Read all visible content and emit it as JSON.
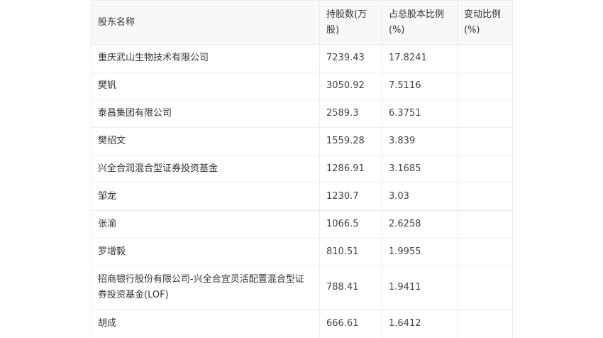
{
  "table": {
    "headers": [
      "股东名称",
      "持股数(万股)",
      "占总股本比例(%)",
      "变动比例(%)"
    ],
    "rows": [
      {
        "name": "重庆武山生物技术有限公司",
        "shares": "7239.43",
        "ratio": "17.8241",
        "change": ""
      },
      {
        "name": "樊钒",
        "shares": "3050.92",
        "ratio": "7.5116",
        "change": ""
      },
      {
        "name": "泰昌集团有限公司",
        "shares": "2589.3",
        "ratio": "6.3751",
        "change": ""
      },
      {
        "name": "樊绍文",
        "shares": "1559.28",
        "ratio": "3.839",
        "change": ""
      },
      {
        "name": "兴全合润混合型证券投资基金",
        "shares": "1286.91",
        "ratio": "3.1685",
        "change": ""
      },
      {
        "name": "邹龙",
        "shares": "1230.7",
        "ratio": "3.03",
        "change": ""
      },
      {
        "name": "张渝",
        "shares": "1066.5",
        "ratio": "2.6258",
        "change": ""
      },
      {
        "name": "罗增毅",
        "shares": "810.51",
        "ratio": "1.9955",
        "change": ""
      },
      {
        "name": "招商银行股份有限公司-兴全合宜灵活配置混合型证券投资基金(LOF)",
        "shares": "788.41",
        "ratio": "1.9411",
        "change": ""
      },
      {
        "name": "胡成",
        "shares": "666.61",
        "ratio": "1.6412",
        "change": ""
      }
    ]
  }
}
